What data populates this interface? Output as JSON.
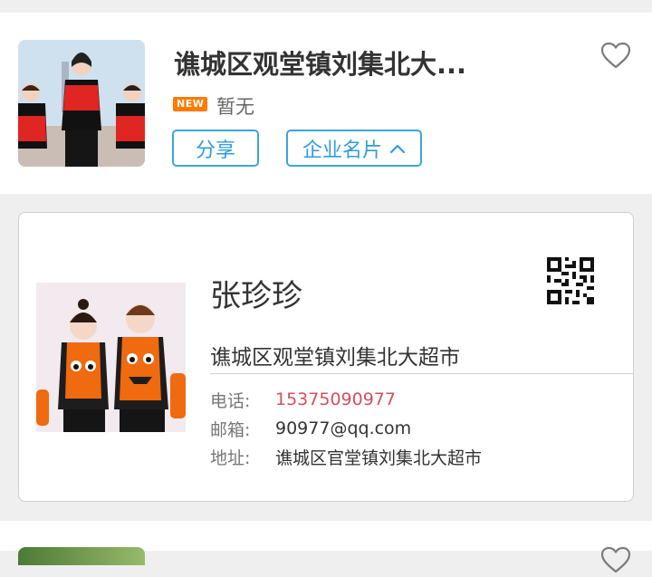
{
  "shop": {
    "title": "谯城区观堂镇刘集北大...",
    "badge": "NEW",
    "status": "暂无",
    "share_label": "分享",
    "card_label": "企业名片",
    "favorite_icon": "heart-outline-icon",
    "card_toggle_icon": "chevron-up-icon"
  },
  "business_card": {
    "name": "张珍珍",
    "company": "谯城区观堂镇刘集北大超市",
    "qr_icon": "qr-code-icon",
    "rows": [
      {
        "label": "电话:",
        "value": "15375090977"
      },
      {
        "label": "邮箱:",
        "value": "90977@qq.com"
      },
      {
        "label": "地址:",
        "value": "谯城区官堂镇刘集北大超市"
      }
    ]
  },
  "colors": {
    "accent": "#3aa5e0",
    "badge": "#ff7a00",
    "phone": "#d3505d"
  }
}
